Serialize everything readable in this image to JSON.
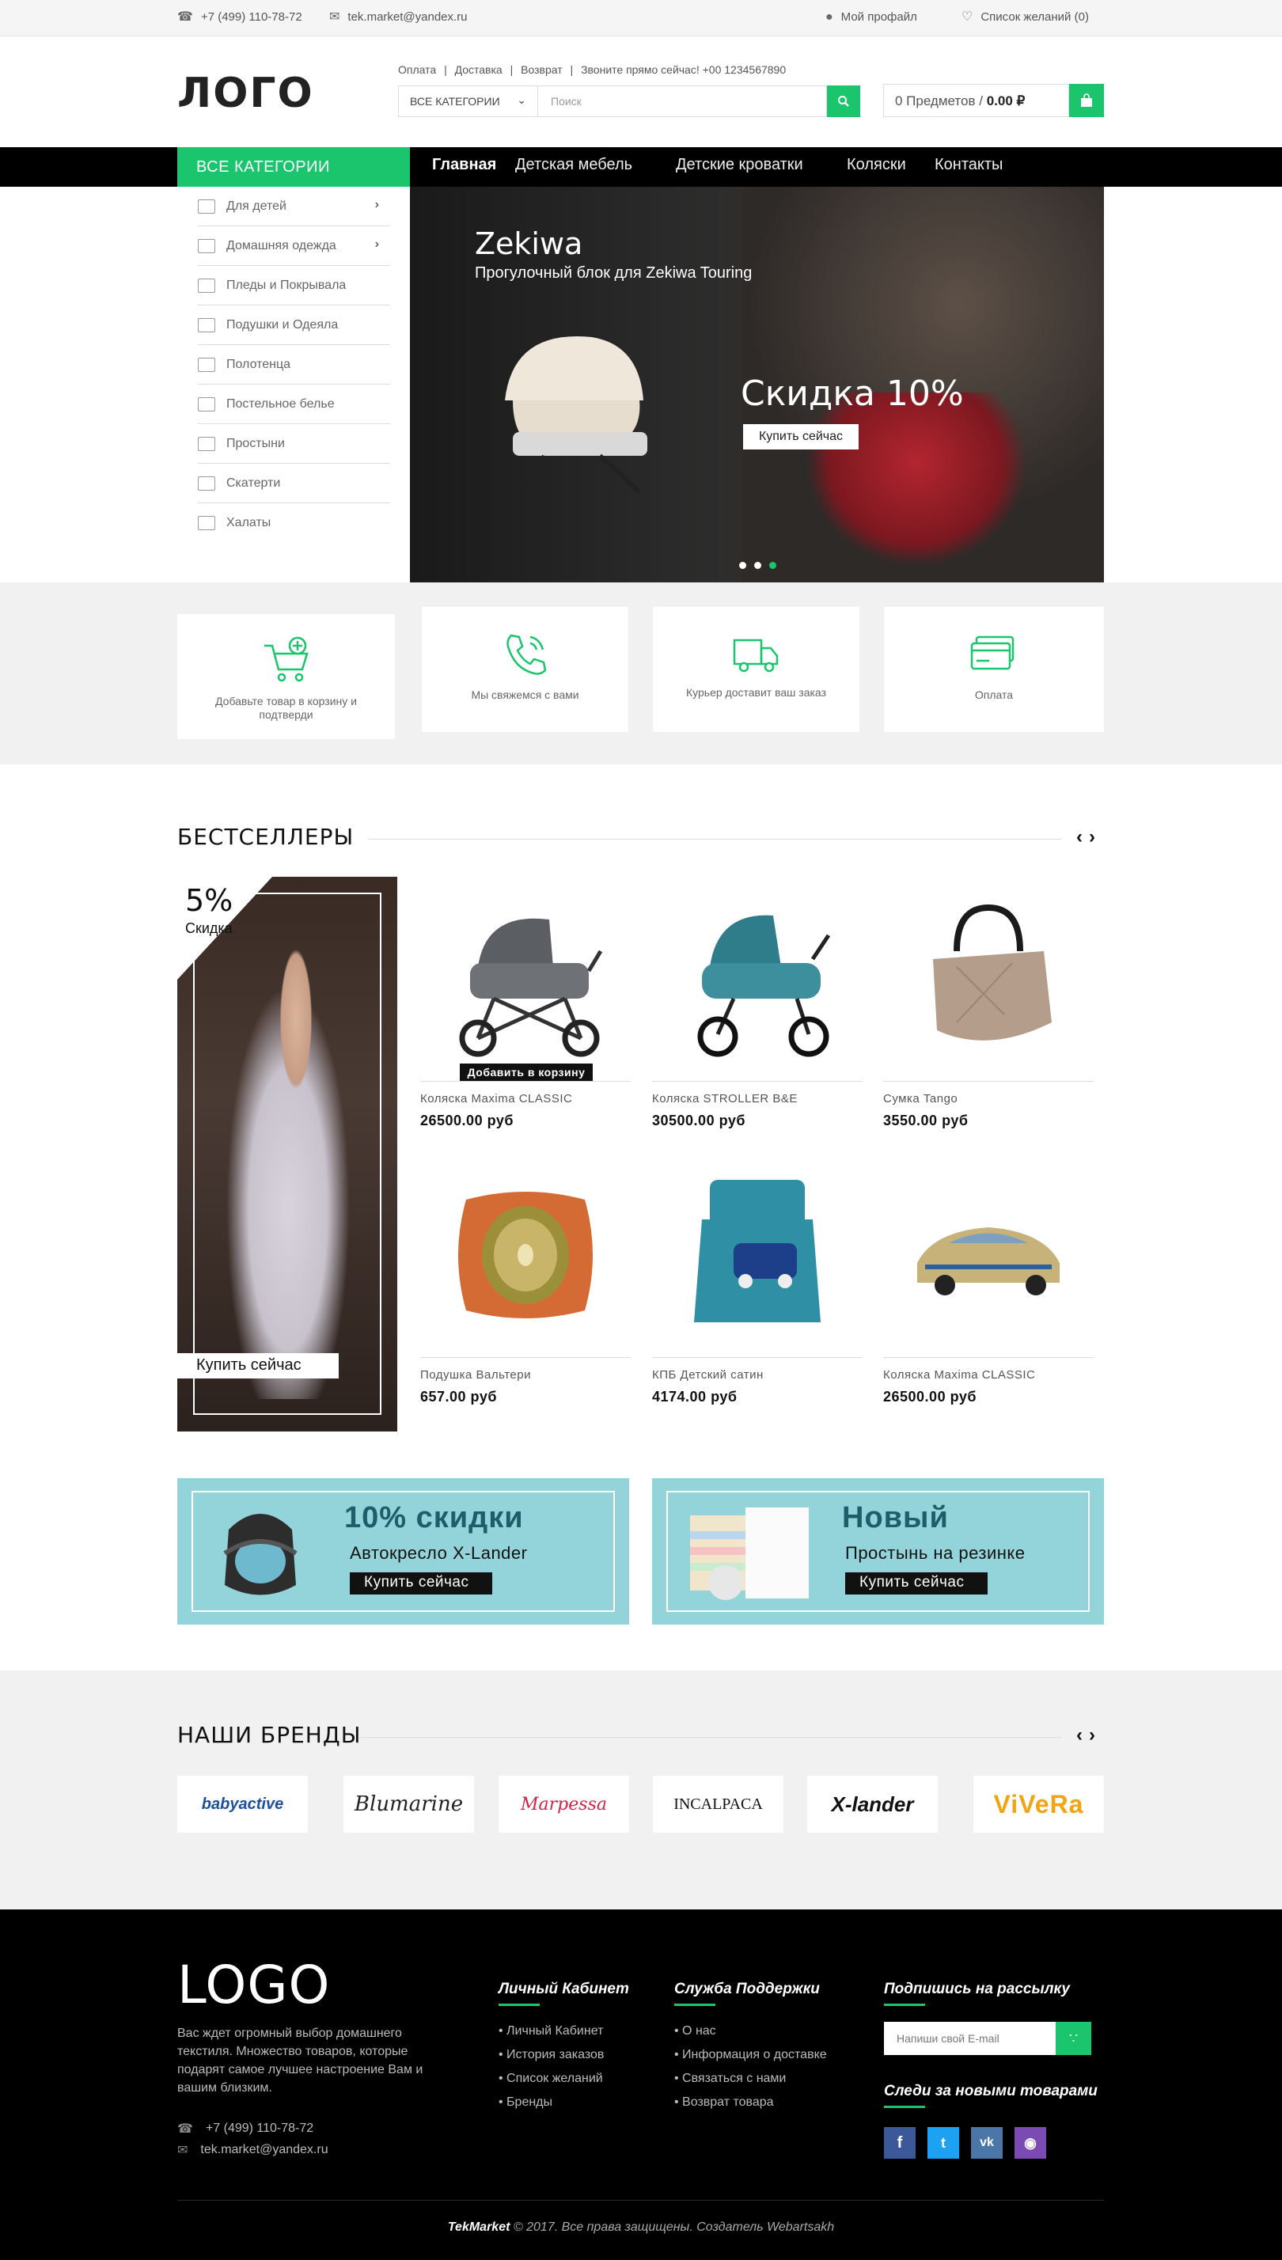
{
  "topbar": {
    "phone": "+7 (499) 110-78-72",
    "email": "tek.market@yandex.ru",
    "profile": "Мой профайл",
    "wishlist": "Список желаний (0)"
  },
  "header": {
    "logo": "ЛОГО",
    "links": [
      "Оплата",
      "|",
      "Доставка",
      "|",
      "Возврат",
      "|",
      "Звоните прямо сейчас! +00 1234567890"
    ],
    "category_select": "ВСЕ КАТЕГОРИИ",
    "search_placeholder": "Поиск",
    "cart_items": "0 Предметов /",
    "cart_total": "0.00 ₽"
  },
  "nav": {
    "all_categories": "ВСЕ КАТЕГОРИИ",
    "items": [
      "Главная",
      "Детская мебель",
      "Детские кроватки",
      "Коляски",
      "Контакты"
    ]
  },
  "sidebar": {
    "items": [
      "Для детей",
      "Домашняя одежда",
      "Пледы и Покрывала",
      "Подушки и Одеяла",
      "Полотенца",
      "Постельное белье",
      "Простыни",
      "Скатерти",
      "Халаты"
    ]
  },
  "hero": {
    "title": "Zekiwa",
    "subtitle": "Прогулочный блок для Zekiwa Touring",
    "discount": "Скидка 10%",
    "button": "Купить сейчас",
    "slides": 3,
    "active_slide": 3
  },
  "features": [
    {
      "text": "Добавьте товар в корзину и подтверди",
      "icon": "cart-plus-icon"
    },
    {
      "text": "Мы свяжемся с вами",
      "icon": "phone-icon"
    },
    {
      "text": "Курьер доставит ваш заказ",
      "icon": "truck-icon"
    },
    {
      "text": "Оплата",
      "icon": "credit-card-icon"
    }
  ],
  "bestsellers": {
    "title": "БЕСТСЕЛЛЕРЫ",
    "promo": {
      "percent": "5%",
      "label": "Скидка",
      "button": "Купить сейчас"
    },
    "add_to_cart": "Добавить в корзину",
    "products": [
      {
        "name": "Коляска Maxima CLASSIC",
        "price": "26500.00 руб"
      },
      {
        "name": "Коляска STROLLER B&E",
        "price": "30500.00 руб"
      },
      {
        "name": "Сумка Tango",
        "price": "3550.00 руб"
      },
      {
        "name": "Подушка Вальтери",
        "price": "657.00 руб"
      },
      {
        "name": "КПБ Детский сатин",
        "price": "4174.00 руб"
      },
      {
        "name": "Коляска Maxima CLASSIC",
        "price": "26500.00 руб"
      }
    ]
  },
  "banners": [
    {
      "title": "10% скидки",
      "subtitle": "Автокресло X-Lander",
      "button": "Купить сейчас"
    },
    {
      "title": "Новый",
      "subtitle": "Простынь на резинке",
      "button": "Купить сейчас"
    }
  ],
  "brands": {
    "title": "НАШИ БРЕНДЫ",
    "items": [
      "babyactive",
      "Blumarine",
      "Marpessa",
      "INCALPACA",
      "X-lander",
      "ViVeRa"
    ]
  },
  "footer": {
    "logo": "LOGO",
    "description": "Вас ждет огромный выбор домашнего текстиля.  Множество товаров, которые подарят самое лучшее настроение Вам и вашим близким.",
    "phone": "+7 (499) 110-78-72",
    "email": "tek.market@yandex.ru",
    "account_title": "Личный Кабинет",
    "account_links": [
      "Личный Кабинет",
      "История заказов",
      "Список желаний",
      "Бренды"
    ],
    "support_title": "Служба Поддержки",
    "support_links": [
      "О нас",
      "Информация о доставке",
      "Связаться с нами",
      "Возврат товара"
    ],
    "subscribe_title": "Подпишись на рассылку",
    "subscribe_placeholder": "Напиши свой E-mail",
    "follow_title": "Следи за новыми товарами",
    "social": [
      "f",
      "t",
      "vk",
      "ig"
    ],
    "copyright_brand": "TekMarket",
    "copyright_text": "© 2017. Все права защищены. Создатель Webartsakh"
  },
  "colors": {
    "accent": "#1bc56d",
    "banner": "#93d3da",
    "footer": "#000000"
  }
}
